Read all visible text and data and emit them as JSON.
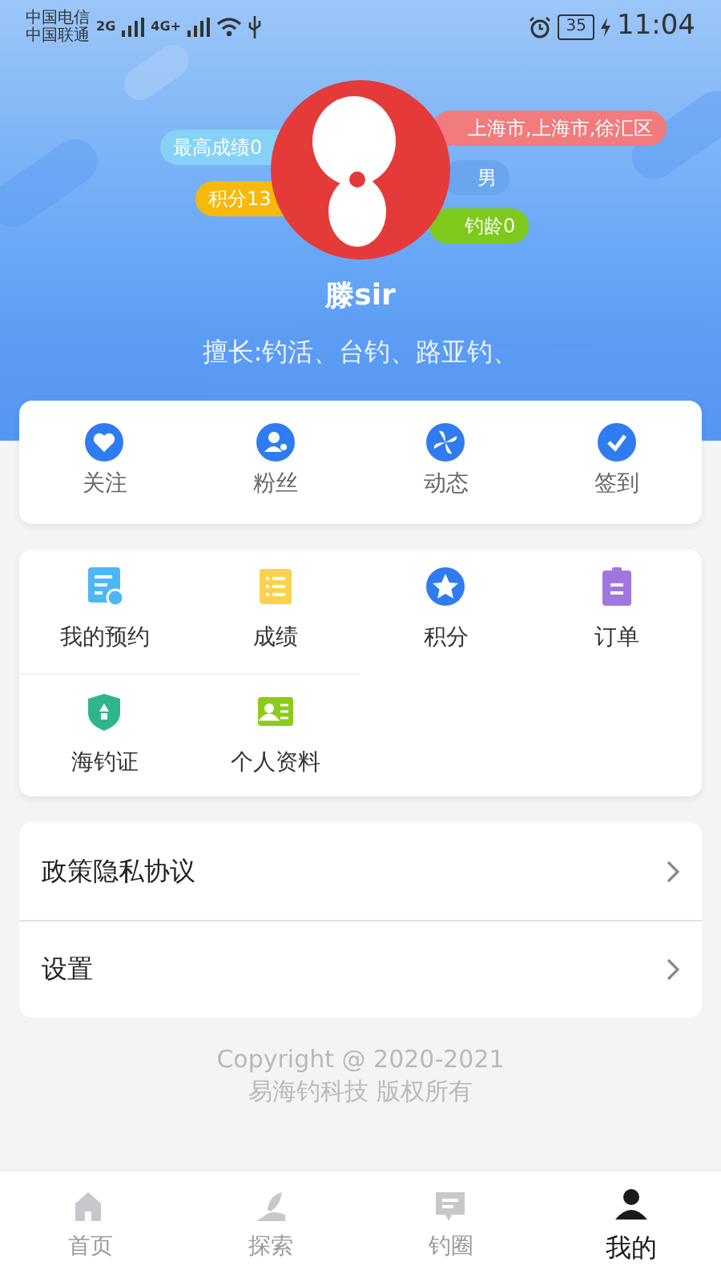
{
  "status_bar": {
    "carriers": [
      "中国电信",
      "中国联通"
    ],
    "network_1": "2G",
    "network_2": "4G+",
    "battery": "35",
    "time": "11:04"
  },
  "profile": {
    "name": "滕sir",
    "specialty": "擅长:钓活、台钓、路亚钓、",
    "left_tags": [
      {
        "text": "最高成绩0",
        "color": "#86d2f6"
      },
      {
        "text": "积分13",
        "color": "#f6b90c"
      }
    ],
    "right_tags": [
      {
        "text": "上海市,上海市,徐汇区",
        "color": "#f17b7d"
      },
      {
        "text": "男",
        "color": "#6aa6ee"
      },
      {
        "text": "钓龄0",
        "color": "#7dc91c"
      }
    ]
  },
  "quick_actions": [
    {
      "label": "关注"
    },
    {
      "label": "粉丝"
    },
    {
      "label": "动态"
    },
    {
      "label": "签到"
    }
  ],
  "services": [
    {
      "label": "我的预约"
    },
    {
      "label": "成绩"
    },
    {
      "label": "积分"
    },
    {
      "label": "订单"
    },
    {
      "label": "海钓证"
    },
    {
      "label": "个人资料"
    }
  ],
  "menu": [
    {
      "label": "政策隐私协议"
    },
    {
      "label": "设置"
    }
  ],
  "footer": [
    "Copyright @ 2020-2021",
    "易海钓科技 版权所有"
  ],
  "tab_bar": [
    {
      "label": "首页",
      "selected": false
    },
    {
      "label": "探索",
      "selected": false
    },
    {
      "label": "钓圈",
      "selected": false
    },
    {
      "label": "我的",
      "selected": true
    }
  ]
}
